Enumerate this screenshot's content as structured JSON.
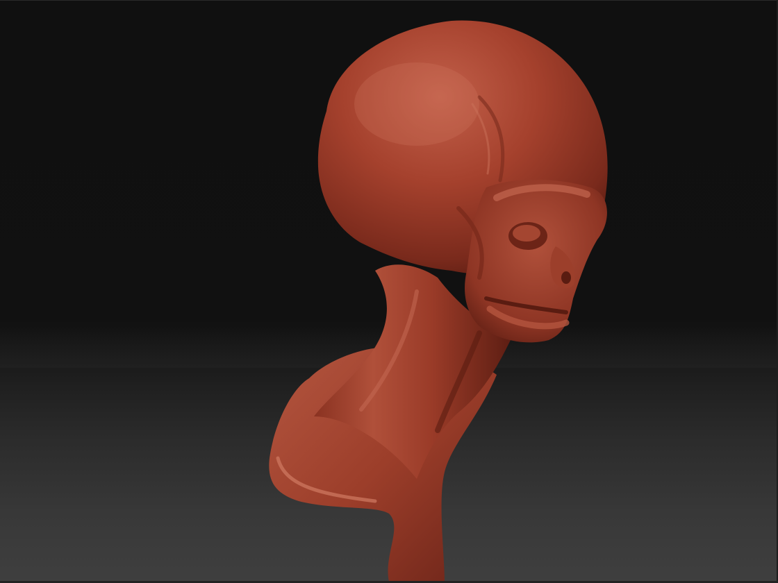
{
  "viewport": {
    "background_top": "#101010",
    "background_bottom": "#3f3f3f"
  },
  "model": {
    "material_color": "#a8402c",
    "highlight_color": "#c9624a",
    "shadow_color": "#5a1d12"
  }
}
